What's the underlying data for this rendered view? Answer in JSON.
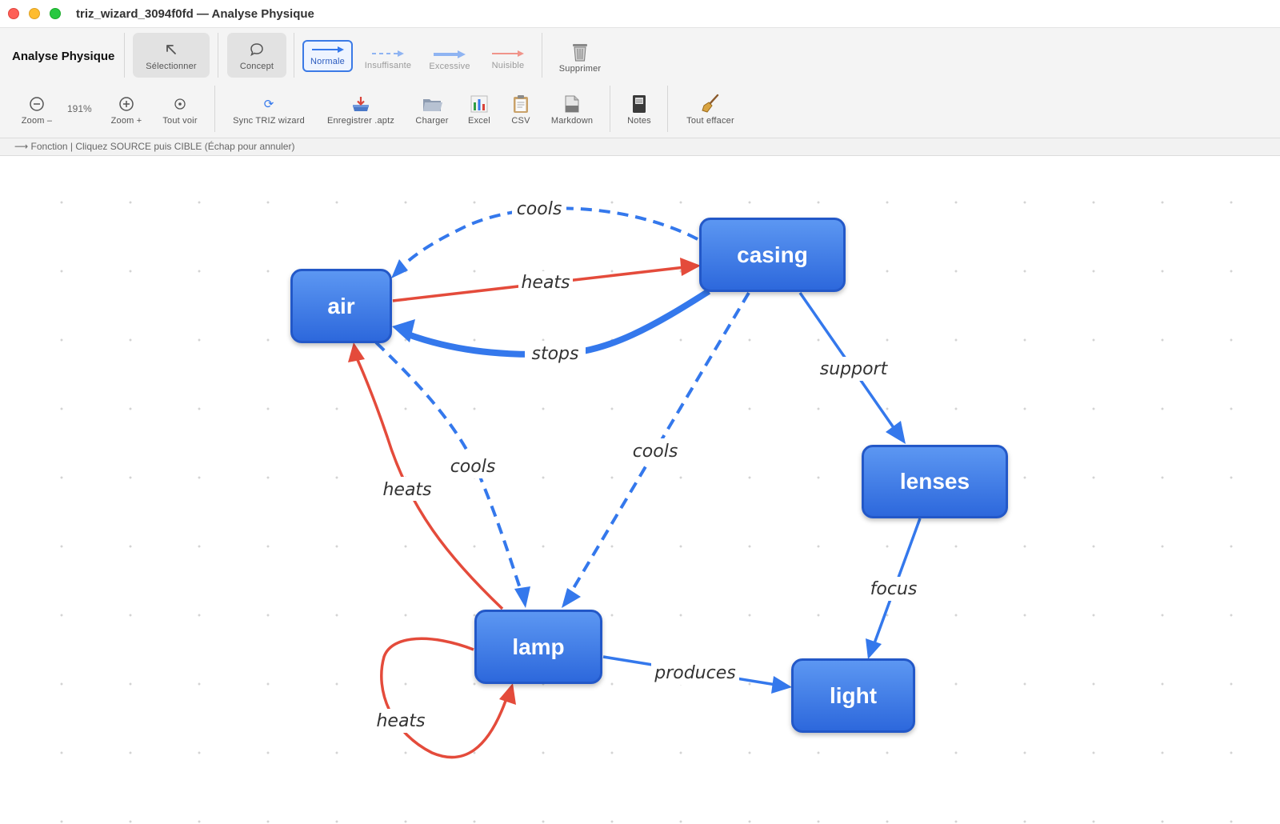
{
  "window": {
    "title": "triz_wizard_3094f0fd — Analyse Physique"
  },
  "toolbar": {
    "app_label": "Analyse Physique",
    "select_label": "Sélectionner",
    "concept_label": "Concept",
    "normal_label": "Normale",
    "insufficient_label": "Insuffisante",
    "excessive_label": "Excessive",
    "harmful_label": "Nuisible",
    "delete_label": "Supprimer",
    "zoom_out_label": "Zoom –",
    "zoom_level": "191%",
    "zoom_in_label": "Zoom +",
    "fit_label": "Tout voir",
    "sync_label": "Sync TRIZ wizard",
    "save_label": "Enregistrer .aptz",
    "load_label": "Charger",
    "excel_label": "Excel",
    "csv_label": "CSV",
    "markdown_label": "Markdown",
    "notes_label": "Notes",
    "clear_label": "Tout effacer"
  },
  "status": {
    "text": "⟶ Fonction | Cliquez SOURCE puis CIBLE (Échap pour annuler)"
  },
  "colors": {
    "normal": "#3478ec",
    "harmful": "#e44b3b",
    "node_fill": "#3d7be6"
  },
  "graph": {
    "nodes": {
      "air": "air",
      "casing": "casing",
      "lenses": "lenses",
      "lamp": "lamp",
      "light": "light"
    },
    "edges": [
      {
        "from": "casing",
        "to": "air",
        "label": "cools",
        "kind": "insufficient"
      },
      {
        "from": "air",
        "to": "casing",
        "label": "heats",
        "kind": "harmful"
      },
      {
        "from": "casing",
        "to": "air",
        "label": "stops",
        "kind": "excessive"
      },
      {
        "from": "casing",
        "to": "lenses",
        "label": "support",
        "kind": "normal"
      },
      {
        "from": "air",
        "to": "lamp",
        "label": "cools",
        "kind": "insufficient"
      },
      {
        "from": "lamp",
        "to": "air",
        "label": "heats",
        "kind": "harmful"
      },
      {
        "from": "casing",
        "to": "lamp",
        "label": "cools",
        "kind": "insufficient"
      },
      {
        "from": "lenses",
        "to": "light",
        "label": "focus",
        "kind": "normal"
      },
      {
        "from": "lamp",
        "to": "light",
        "label": "produces",
        "kind": "normal"
      },
      {
        "from": "lamp",
        "to": "lamp",
        "label": "heats",
        "kind": "harmful"
      }
    ]
  }
}
